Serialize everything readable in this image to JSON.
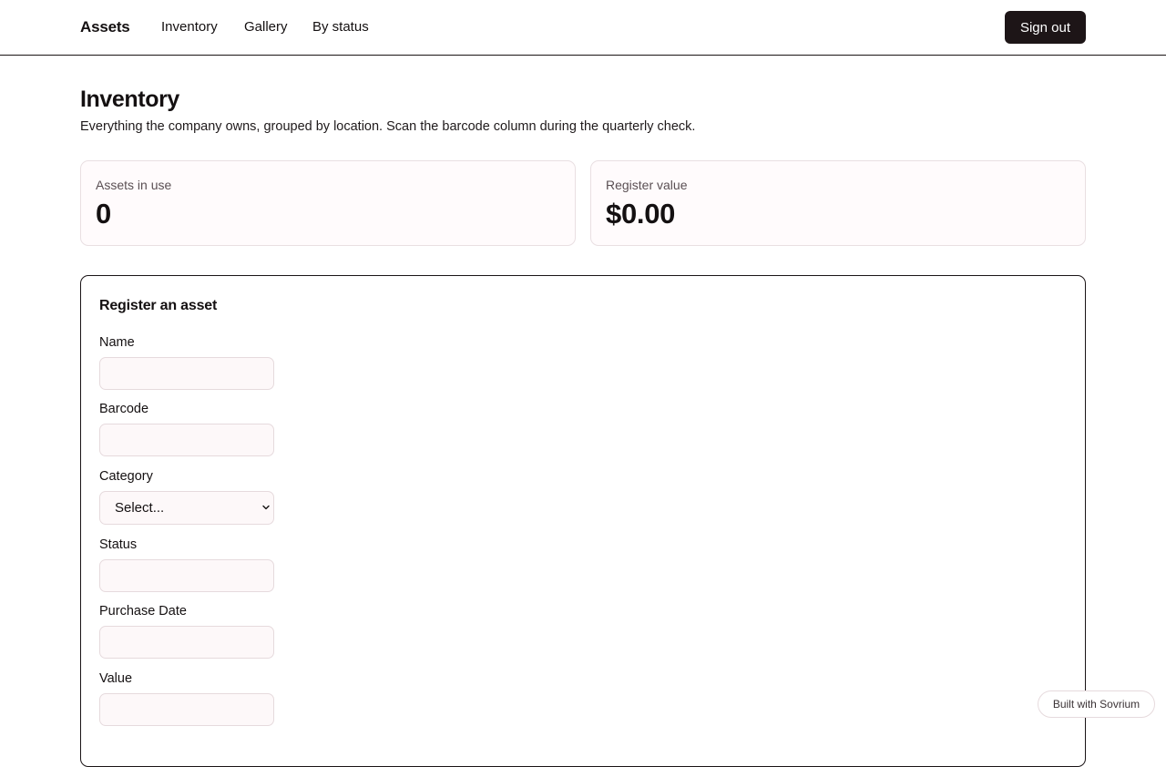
{
  "header": {
    "brand": "Assets",
    "nav": [
      "Inventory",
      "Gallery",
      "By status"
    ],
    "signout_label": "Sign out"
  },
  "page": {
    "title": "Inventory",
    "subtitle": "Everything the company owns, grouped by location. Scan the barcode column during the quarterly check."
  },
  "stats": [
    {
      "label": "Assets in use",
      "value": "0"
    },
    {
      "label": "Register value",
      "value": "$0.00"
    }
  ],
  "form": {
    "title": "Register an asset",
    "fields": {
      "name": {
        "label": "Name",
        "value": ""
      },
      "barcode": {
        "label": "Barcode",
        "value": ""
      },
      "category": {
        "label": "Category",
        "selected": "Select..."
      },
      "status": {
        "label": "Status",
        "value": ""
      },
      "purchase_date": {
        "label": "Purchase Date",
        "value": ""
      },
      "value": {
        "label": "Value",
        "value": ""
      }
    }
  },
  "badge": {
    "label": "Built with Sovrium"
  },
  "colors": {
    "primary_dark": "#1d1517",
    "card_background": "#fffbfc",
    "input_background": "#fdf8f9",
    "border_light": "#e6dadd"
  },
  "icons": {
    "select_chevron": "chevron-down-icon"
  }
}
